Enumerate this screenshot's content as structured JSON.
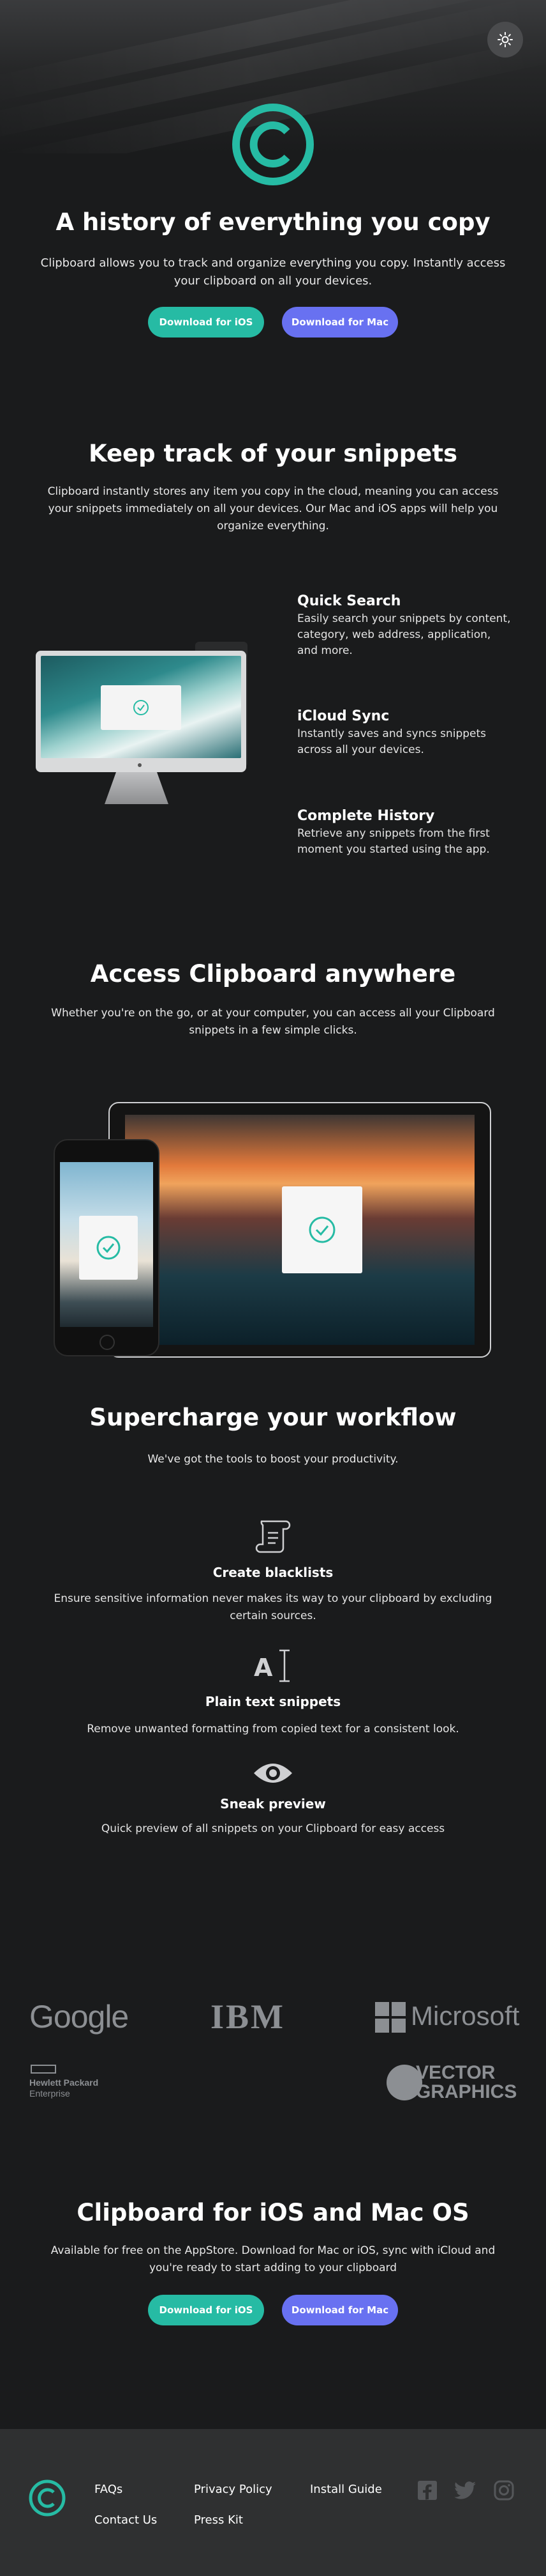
{
  "colors": {
    "accent_teal": "#26bba4",
    "accent_purple": "#6871f1",
    "background": "#1a1b1c",
    "footer": "#2f3031"
  },
  "header": {
    "theme_toggle_icon": "sun-icon",
    "logo_icon": "copyright-logo-icon"
  },
  "hero": {
    "title": "A history of everything you copy",
    "text": "Clipboard allows you to track and organize everything you copy. Instantly access your clipboard on all your devices.",
    "ios_button": "Download for iOS",
    "mac_button": "Download for Mac"
  },
  "snippets": {
    "title": "Keep track of your snippets",
    "text": "Clipboard instantly stores any item you copy in the cloud, meaning you can access your snippets immediately on all your devices. Our Mac and iOS apps will help you organize everything.",
    "features": [
      {
        "title": "Quick Search",
        "text": "Easily search your snippets by content, category, web address, application, and more."
      },
      {
        "title": "iCloud Sync",
        "text": "Instantly saves and syncs snippets across all your devices."
      },
      {
        "title": "Complete History",
        "text": "Retrieve any snippets from the first moment you started using the app."
      }
    ]
  },
  "access": {
    "title": "Access Clipboard anywhere",
    "text": "Whether you're on the go, or at your computer, you can access all your Clipboard snippets in a few simple clicks."
  },
  "workflow": {
    "title": "Supercharge your workflow",
    "subtitle": "We've got the tools to boost your productivity.",
    "tools": [
      {
        "icon": "blacklist-scroll-icon",
        "title": "Create blacklists",
        "text": "Ensure sensitive information never makes its way to your clipboard by excluding certain sources."
      },
      {
        "icon": "text-cursor-icon",
        "title": "Plain text snippets",
        "text": "Remove unwanted formatting from copied text for a consistent look."
      },
      {
        "icon": "eye-icon",
        "title": "Sneak preview",
        "text": "Quick preview of all snippets on your Clipboard for easy access"
      }
    ]
  },
  "partners": {
    "google": "Google",
    "ibm": "IBM",
    "microsoft": "Microsoft",
    "hp_line1": "Hewlett Packard",
    "hp_line2": "Enterprise",
    "vector_line1": "VECTOR",
    "vector_line2": "GRAPHICS"
  },
  "cta": {
    "title": "Clipboard for iOS and Mac OS",
    "text": "Available for free on the AppStore. Download for Mac or iOS, sync with iCloud and you're ready to start adding to your clipboard",
    "ios_button": "Download for iOS",
    "mac_button": "Download for Mac"
  },
  "footer": {
    "links": [
      "FAQs",
      "Contact Us",
      "Privacy Policy",
      "Press Kit",
      "Install Guide"
    ],
    "social_icons": [
      "facebook-icon",
      "twitter-icon",
      "instagram-icon"
    ]
  }
}
